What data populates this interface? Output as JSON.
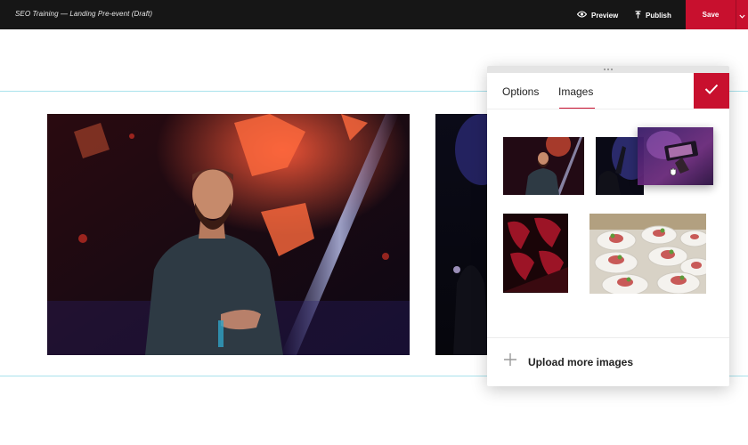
{
  "topbar": {
    "title": "SEO Training — Landing Pre-event (Draft)",
    "preview_label": "Preview",
    "publish_label": "Publish",
    "save_label": "Save"
  },
  "panel": {
    "tabs": [
      {
        "label": "Options",
        "active": false
      },
      {
        "label": "Images",
        "active": true
      }
    ],
    "upload_label": "Upload more images"
  },
  "icons": {
    "preview": "eye-icon",
    "publish": "upload-arrow-icon",
    "save_dropdown": "chevron-down-icon",
    "confirm": "checkmark-icon",
    "upload": "plus-icon",
    "drag_cursor": "grab-hand-icon",
    "panel_handle": "drag-handle-icon"
  },
  "colors": {
    "accent": "#c8102e",
    "topbar": "#161616",
    "guide": "#a9e2ec"
  }
}
